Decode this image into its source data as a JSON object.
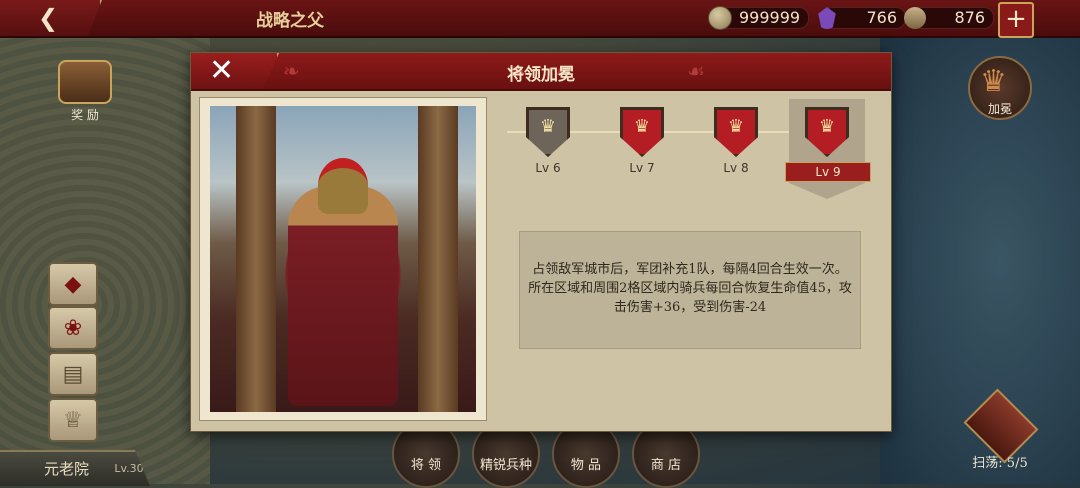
{
  "topbar": {
    "title": "战略之父",
    "coins": "999999",
    "gems": "766",
    "crates": "876",
    "plus": "+"
  },
  "left": {
    "reward_label": "奖 励",
    "senate_name": "元老院",
    "senate_level": "Lv.30"
  },
  "right": {
    "crown_label": "加冕",
    "sweep_label": "扫荡: 5/5"
  },
  "bottom_nav": [
    {
      "label": "将 领"
    },
    {
      "label": "精锐兵种"
    },
    {
      "label": "物 品"
    },
    {
      "label": "商 店"
    }
  ],
  "dialog": {
    "title": "将领加冕",
    "levels": [
      {
        "label": "Lv 6",
        "state": "locked"
      },
      {
        "label": "Lv 7",
        "state": "unlocked"
      },
      {
        "label": "Lv 8",
        "state": "unlocked"
      },
      {
        "label": "Lv 9",
        "state": "selected"
      }
    ],
    "description": "占领敌军城市后，军团补充1队，每隔4回合生效一次。所在区域和周围2格区域内骑兵每回合恢复生命值45，攻击伤害+36，受到伤害-24"
  },
  "colors": {
    "header_red": "#6a1414",
    "shield_red": "#b51d24",
    "shield_gray": "#6d645a",
    "panel_beige": "#cfc3a6"
  }
}
